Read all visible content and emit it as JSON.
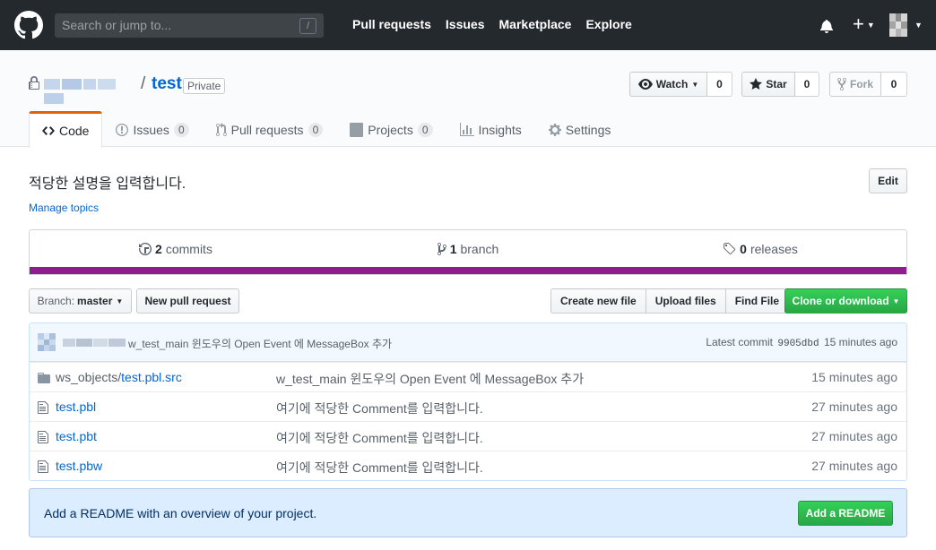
{
  "header": {
    "search_placeholder": "Search or jump to...",
    "search_shortcut": "/",
    "nav": [
      "Pull requests",
      "Issues",
      "Marketplace",
      "Explore"
    ],
    "plus_label": "+"
  },
  "repo": {
    "name": "test",
    "separator": "/",
    "visibility_label": "Private",
    "watch": {
      "label": "Watch",
      "count": "0"
    },
    "star": {
      "label": "Star",
      "count": "0"
    },
    "fork": {
      "label": "Fork",
      "count": "0"
    }
  },
  "tabs": [
    {
      "label": "Code",
      "counter": null,
      "selected": true
    },
    {
      "label": "Issues",
      "counter": "0"
    },
    {
      "label": "Pull requests",
      "counter": "0"
    },
    {
      "label": "Projects",
      "counter": "0"
    },
    {
      "label": "Insights",
      "counter": null
    },
    {
      "label": "Settings",
      "counter": null
    }
  ],
  "description": "적당한 설명을 입력합니다.",
  "edit_label": "Edit",
  "manage_topics": "Manage topics",
  "summary": {
    "commits_count": "2",
    "commits_label": "commits",
    "branches_count": "1",
    "branches_label": "branch",
    "releases_count": "0",
    "releases_label": "releases",
    "language_color": "#8f1d8f"
  },
  "file_nav": {
    "branch_prefix": "Branch:",
    "branch_name": "master",
    "new_pr": "New pull request",
    "create_file": "Create new file",
    "upload_files": "Upload files",
    "find_file": "Find File",
    "clone": "Clone or download"
  },
  "commit": {
    "message": "w_test_main 윈도우의 Open Event 에 MessageBox 추가",
    "latest_prefix": "Latest commit",
    "sha": "9905dbd",
    "age": "15 minutes ago"
  },
  "files": [
    {
      "type": "dir",
      "dir_part": "ws_objects/",
      "name_part": "test.pbl.src",
      "message": "w_test_main 윈도우의 Open Event 에 MessageBox 추가",
      "age": "15 minutes ago"
    },
    {
      "type": "file",
      "dir_part": "",
      "name_part": "test.pbl",
      "message": "여기에 적당한 Comment를 입력합니다.",
      "age": "27 minutes ago"
    },
    {
      "type": "file",
      "dir_part": "",
      "name_part": "test.pbt",
      "message": "여기에 적당한 Comment를 입력합니다.",
      "age": "27 minutes ago"
    },
    {
      "type": "file",
      "dir_part": "",
      "name_part": "test.pbw",
      "message": "여기에 적당한 Comment를 입력합니다.",
      "age": "27 minutes ago"
    }
  ],
  "readme": {
    "text": "Add a README with an overview of your project.",
    "button": "Add a README"
  }
}
